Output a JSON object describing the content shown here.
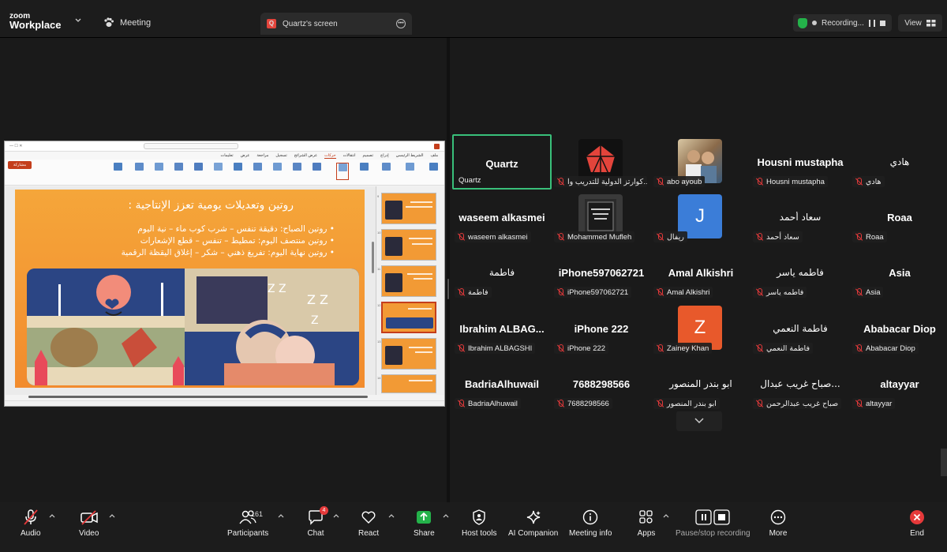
{
  "app": {
    "logo_line1": "zoom",
    "logo_line2": "Workplace",
    "meeting_tab": "Meeting",
    "screen_tab": "Quartz's screen",
    "screen_tab_badge": "Q",
    "recording": "Recording...",
    "view": "View"
  },
  "slide": {
    "title": "روتين وتعديلات يومية تعزز الإنتاجية :",
    "bullets": [
      "روتين الصباح: دقيقة تنفس – شرب كوب ماء – نية اليوم",
      "روتين منتصف اليوم: تمطيط – تنفس – قطع الإشعارات",
      "روتين نهاية اليوم: تفريغ ذهني – شكر – إغلاق اليقظة الرقمية"
    ],
    "thumb_numbers": [
      "9",
      "10",
      "11",
      "12",
      "13",
      "14"
    ],
    "share_label": "مشاركة",
    "tabs": [
      "ملف",
      "الشريط الرئيسي",
      "إدراج",
      "تصميم",
      "انتقالات",
      "حركات",
      "عرض الشرائح",
      "تسجيل",
      "مراجعة",
      "عرض",
      "تعليمات"
    ],
    "active_tab": "حركات"
  },
  "participants": [
    {
      "big": "Quartz",
      "label": "Quartz",
      "active": true,
      "muted": false
    },
    {
      "big": "",
      "label": "كوارتز الدولية للتدريب وا...",
      "avatar": "quartz-logo"
    },
    {
      "big": "",
      "label": "abo ayoub",
      "avatar": "photo"
    },
    {
      "big": "Housni mustapha",
      "label": "Housni mustapha"
    },
    {
      "big": "هادي",
      "label": "هادي",
      "ar": true
    },
    {
      "big": "waseem alkasmei",
      "label": "waseem alkasmei"
    },
    {
      "big": "",
      "label": "Mohammed Mufleh",
      "avatar": "book"
    },
    {
      "big": "",
      "label": "ريفال",
      "avatar": "letter",
      "letter": "J",
      "color": "#3b7dd8"
    },
    {
      "big": "سعاد أحمد",
      "label": "سعاد أحمد",
      "ar": true
    },
    {
      "big": "Roaa",
      "label": "Roaa"
    },
    {
      "big": "فاطمة",
      "label": "فاطمة",
      "ar": true
    },
    {
      "big": "iPhone597062721",
      "label": "iPhone597062721"
    },
    {
      "big": "Amal Alkishri",
      "label": "Amal Alkishri"
    },
    {
      "big": "فاطمه ياسر",
      "label": "فاطمه ياسر",
      "ar": true
    },
    {
      "big": "Asia",
      "label": "Asia"
    },
    {
      "big": "Ibrahim  ALBAG...",
      "label": "Ibrahim ALBAGSHI"
    },
    {
      "big": "iPhone 222",
      "label": "iPhone 222"
    },
    {
      "big": "",
      "label": "Zainey Khan",
      "avatar": "letter",
      "letter": "Z",
      "color": "#e8592b"
    },
    {
      "big": "فاطمة النعمي",
      "label": "فاطمة النعمي",
      "ar": true
    },
    {
      "big": "Ababacar Diop",
      "label": "Ababacar Diop"
    },
    {
      "big": "BadriaAlhuwail",
      "label": "BadriaAlhuwail"
    },
    {
      "big": "7688298566",
      "label": "7688298566"
    },
    {
      "big": "ابو بندر المنصور",
      "label": "ابو بندر المنصور",
      "ar": true
    },
    {
      "big": "صباح غريب عبدال...",
      "label": "صباح غريب عبدالرحمن",
      "ar": true
    },
    {
      "big": "altayyar",
      "label": "altayyar"
    }
  ],
  "toolbar": {
    "audio": "Audio",
    "video": "Video",
    "participants": "Participants",
    "participants_count": "161",
    "chat": "Chat",
    "chat_badge": "4",
    "react": "React",
    "share": "Share",
    "host_tools": "Host tools",
    "ai_companion": "AI Companion",
    "meeting_info": "Meeting info",
    "apps": "Apps",
    "pause_stop": "Pause/stop recording",
    "more": "More",
    "end": "End"
  },
  "colors": {
    "active_border": "#39c07a",
    "mute_red": "#e5393a",
    "share_green": "#24b24a",
    "slide_orange": "#f28b2d"
  }
}
